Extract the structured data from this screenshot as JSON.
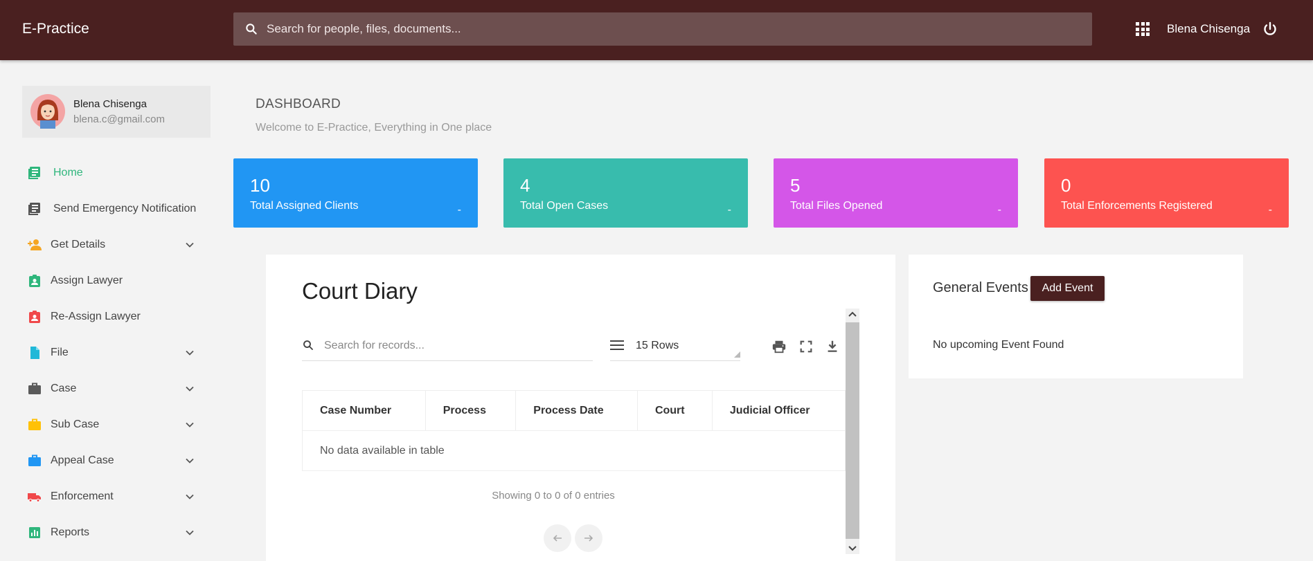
{
  "topbar": {
    "brand": "E-Practice",
    "search_placeholder": "Search for people, files, documents...",
    "user_name": "Blena Chisenga"
  },
  "profile": {
    "name": "Blena Chisenga",
    "email": "blena.c@gmail.com"
  },
  "sidebar": {
    "items": [
      {
        "label": "Home",
        "icon": "news-icon",
        "color": "#2fb67c",
        "active": true
      },
      {
        "label": "Send Emergency Notification",
        "icon": "news-icon",
        "color": "#555555"
      },
      {
        "label": "Get Details",
        "icon": "person-add-icon",
        "color": "#f5a623",
        "expandable": true
      },
      {
        "label": "Assign Lawyer",
        "icon": "badge-icon",
        "color": "#2fb67c"
      },
      {
        "label": "Re-Assign Lawyer",
        "icon": "badge-icon",
        "color": "#f0484a"
      },
      {
        "label": "File",
        "icon": "file-icon",
        "color": "#20b8d8",
        "expandable": true
      },
      {
        "label": "Case",
        "icon": "briefcase-icon",
        "color": "#5a5a5a",
        "expandable": true
      },
      {
        "label": "Sub Case",
        "icon": "briefcase-icon",
        "color": "#ffc107",
        "expandable": true
      },
      {
        "label": "Appeal Case",
        "icon": "briefcase-icon",
        "color": "#2196f3",
        "expandable": true
      },
      {
        "label": "Enforcement",
        "icon": "truck-icon",
        "color": "#f0484a",
        "expandable": true
      },
      {
        "label": "Reports",
        "icon": "chart-icon",
        "color": "#2fb67c",
        "expandable": true
      }
    ]
  },
  "dashboard": {
    "title": "DASHBOARD",
    "subtitle": "Welcome to E-Practice, Everything in One place"
  },
  "cards": [
    {
      "value": "10",
      "label": "Total Assigned Clients",
      "color": "#2196f3",
      "dash": "-"
    },
    {
      "value": "4",
      "label": "Total Open Cases",
      "color": "#38bcad",
      "dash": "-"
    },
    {
      "value": "5",
      "label": "Total Files Opened",
      "color": "#d456e8",
      "dash": "-"
    },
    {
      "value": "0",
      "label": "Total Enforcements Registered",
      "color": "#fd5350",
      "dash": "-"
    }
  ],
  "court_diary": {
    "title": "Court Diary",
    "search_placeholder": "Search for records...",
    "rows_label": "15 Rows",
    "columns": [
      "Case Number",
      "Process",
      "Process Date",
      "Court",
      "Judicial Officer"
    ],
    "empty_text": "No data available in table",
    "info": "Showing 0 to 0 of 0 entries"
  },
  "events": {
    "title": "General Events",
    "add_label": "Add Event",
    "empty_text": "No upcoming Event Found"
  }
}
